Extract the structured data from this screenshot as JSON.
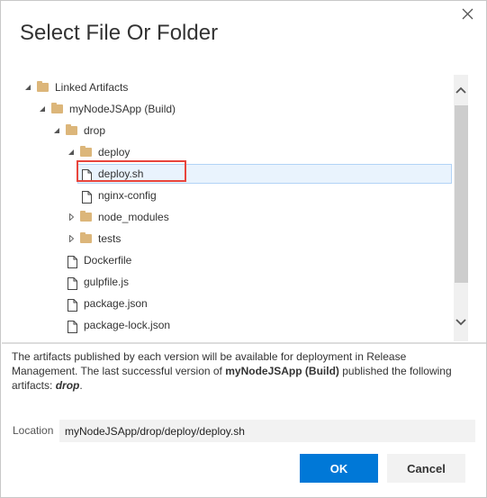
{
  "dialog": {
    "title": "Select File Or Folder",
    "close_icon": "close-icon"
  },
  "tree": {
    "items": [
      {
        "label": "Linked Artifacts",
        "type": "folder",
        "level": 0,
        "expanded": true
      },
      {
        "label": "myNodeJSApp (Build)",
        "type": "folder",
        "level": 1,
        "expanded": true
      },
      {
        "label": "drop",
        "type": "folder",
        "level": 2,
        "expanded": true
      },
      {
        "label": "deploy",
        "type": "folder",
        "level": 3,
        "expanded": true
      },
      {
        "label": "deploy.sh",
        "type": "file",
        "level": 4,
        "selected": true
      },
      {
        "label": "nginx-config",
        "type": "file",
        "level": 4
      },
      {
        "label": "node_modules",
        "type": "folder",
        "level": 3,
        "expanded": false
      },
      {
        "label": "tests",
        "type": "folder",
        "level": 3,
        "expanded": false
      },
      {
        "label": "Dockerfile",
        "type": "file",
        "level": 3
      },
      {
        "label": "gulpfile.js",
        "type": "file",
        "level": 3
      },
      {
        "label": "package.json",
        "type": "file",
        "level": 3
      },
      {
        "label": "package-lock.json",
        "type": "file",
        "level": 3
      },
      {
        "label": "",
        "type": "file",
        "level": 3
      }
    ]
  },
  "info": {
    "text_1": "The artifacts published by each version will be available for deployment in Release Management. The last successful version of ",
    "bold_build": "myNodeJSApp (Build)",
    "text_2": " published the following artifacts: ",
    "artifact": "drop",
    "text_3": "."
  },
  "location": {
    "label": "Location",
    "value": "myNodeJSApp/drop/deploy/deploy.sh"
  },
  "buttons": {
    "ok": "OK",
    "cancel": "Cancel"
  },
  "colors": {
    "primary": "#0078d7",
    "selection_bg": "#e9f3fd",
    "highlight": "#e8453c",
    "folder": "#dcb67a"
  }
}
